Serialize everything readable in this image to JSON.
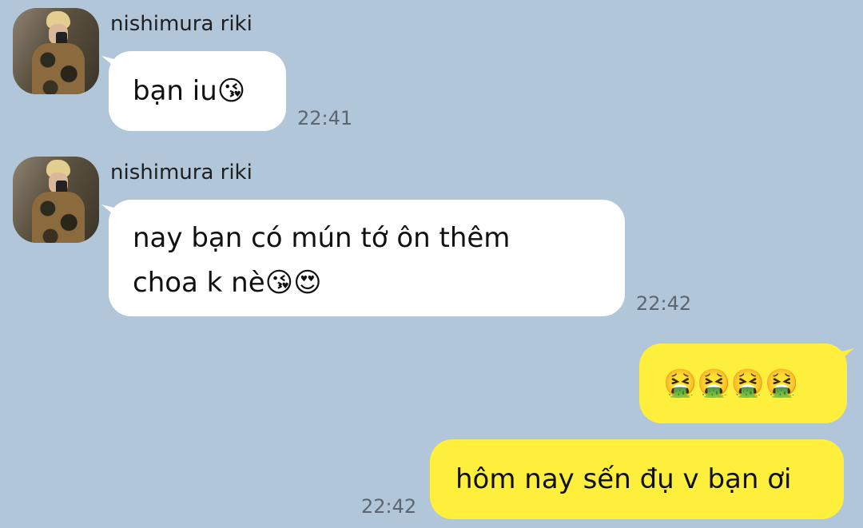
{
  "messages": [
    {
      "sender": "nishimura riki",
      "text": "bạn iu😘",
      "time": "22:41"
    },
    {
      "sender": "nishimura riki",
      "text": "nay bạn có mún tớ ôn thêm\nchoa k nè😘😍",
      "time": "22:42"
    },
    {
      "sender": "me",
      "text": "🤮🤮🤮🤮"
    },
    {
      "sender": "me",
      "text": "hôm nay sến đụ v bạn ơi",
      "time": "22:42"
    }
  ],
  "colors": {
    "background": "#b2c6da",
    "incoming_bubble": "#ffffff",
    "outgoing_bubble": "#fdef3c",
    "timestamp": "#5d6670"
  },
  "icons": {
    "avatar": "profile-photo"
  }
}
